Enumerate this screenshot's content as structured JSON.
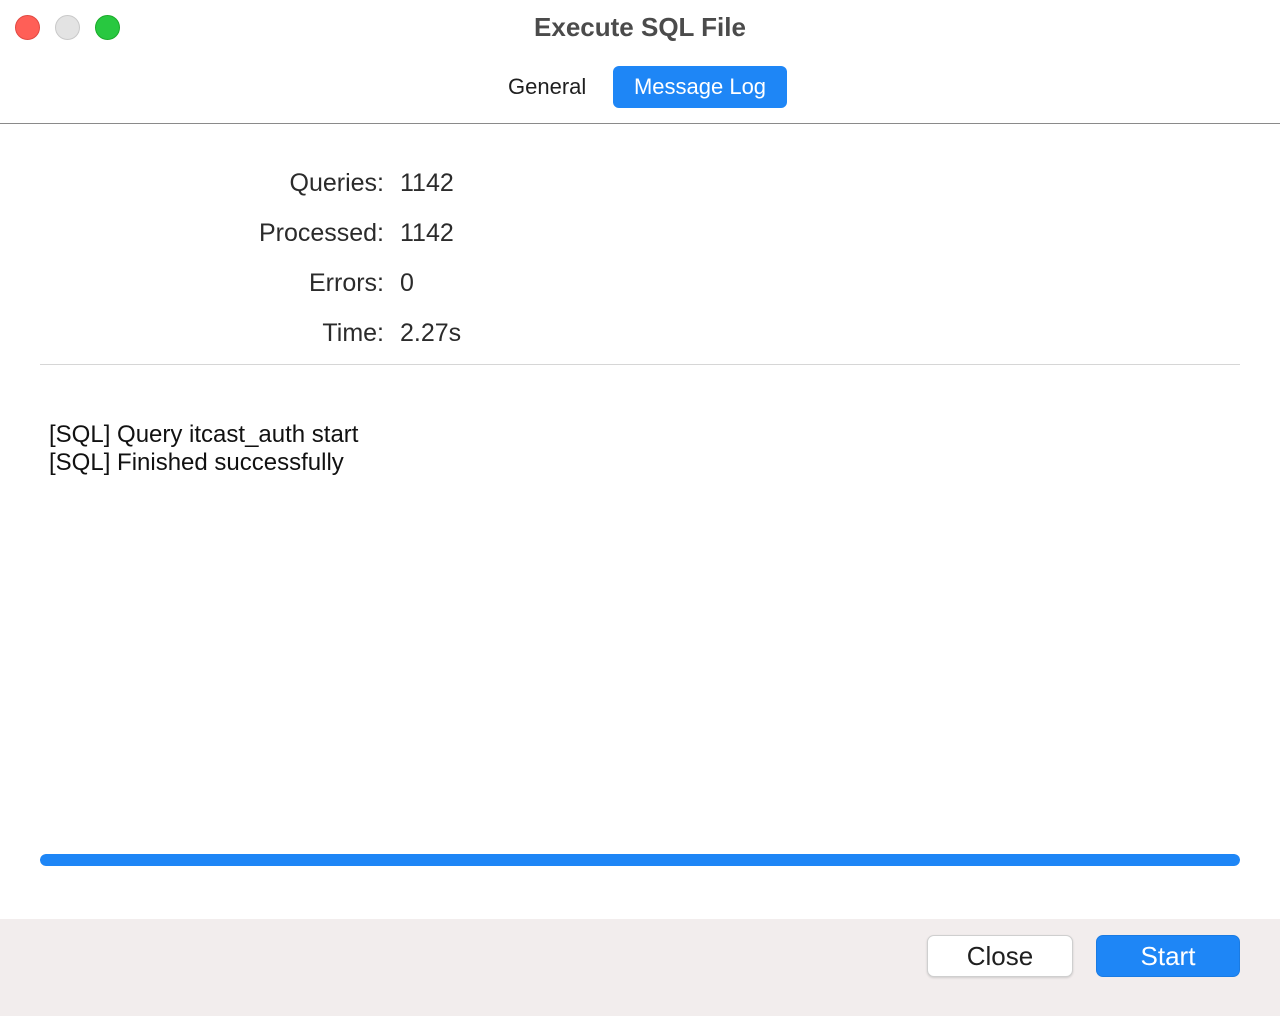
{
  "window": {
    "title": "Execute SQL File"
  },
  "tabs": [
    {
      "label": "General",
      "active": false
    },
    {
      "label": "Message Log",
      "active": true
    }
  ],
  "stats": {
    "queries_label": "Queries:",
    "queries_value": "1142",
    "processed_label": "Processed:",
    "processed_value": "1142",
    "errors_label": "Errors:",
    "errors_value": "0",
    "time_label": "Time:",
    "time_value": "2.27s"
  },
  "log": {
    "lines": [
      "[SQL] Query itcast_auth start",
      "[SQL] Finished successfully"
    ]
  },
  "progress": {
    "fraction": 1.0
  },
  "buttons": {
    "close_label": "Close",
    "start_label": "Start"
  },
  "colors": {
    "accent": "#1e86f6",
    "footer_bg": "#f2eded"
  }
}
